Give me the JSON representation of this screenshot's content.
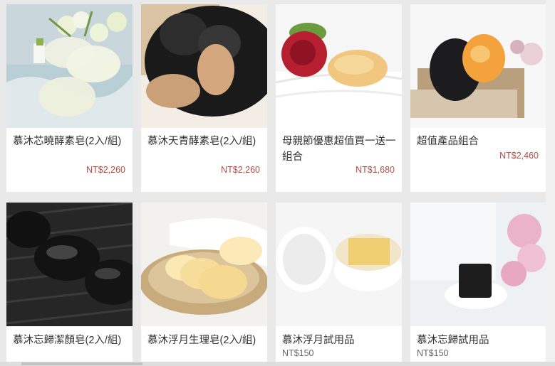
{
  "products": [
    {
      "name": "慕沐芯曉酵素皂(2入/組)",
      "price": "NT$2,260"
    },
    {
      "name": "慕沐天青酵素皂(2入/組)",
      "price": "NT$2,260"
    },
    {
      "name": "母親節優惠超值買一送一組合",
      "price": "NT$1,680"
    },
    {
      "name": "超值產品組合",
      "price": "NT$2,460"
    },
    {
      "name": "慕沐忘歸潔顏皂(2入/組)",
      "price": ""
    },
    {
      "name": "慕沐浮月生理皂(2入/組)",
      "price": ""
    },
    {
      "name": "慕沐浮月試用品",
      "price": "NT$150"
    },
    {
      "name": "慕沐忘歸試用品",
      "price": "NT$150"
    }
  ],
  "images": [
    "soap-with-white-flowers-image",
    "black-and-brown-soaps-image",
    "soap-with-red-rose-image",
    "black-and-orange-soaps-image",
    "black-stones-image",
    "clear-soaps-plate-image",
    "soap-in-jar-image",
    "black-soap-with-pink-flowers-image"
  ],
  "colors": {
    "price": "#b24b45",
    "price_muted": "#666666",
    "background": "#e9e9e9"
  }
}
